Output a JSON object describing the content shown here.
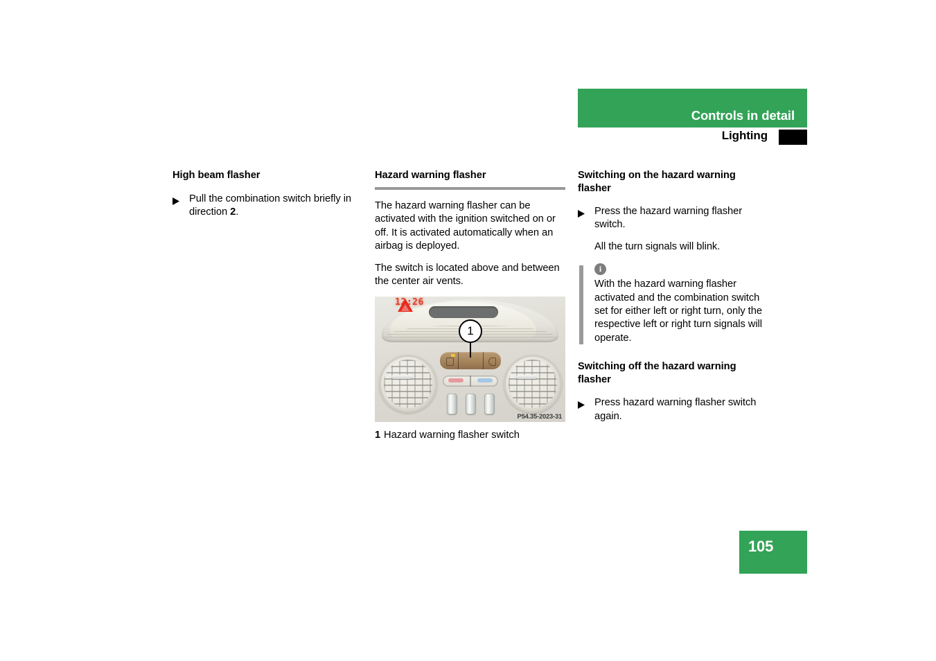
{
  "header": {
    "chapter_title": "Controls in detail",
    "section_title": "Lighting",
    "accent_color": "#33a357",
    "tab_color": "#000000"
  },
  "page_number": "105",
  "columns": {
    "col1": {
      "heading": "High beam flasher",
      "bullets": [
        {
          "text_before": "Pull the combination switch briefly in direction ",
          "bold": "2",
          "text_after": "."
        }
      ]
    },
    "col2": {
      "heading": "Hazard warning flasher",
      "has_rule": true,
      "paragraphs": [
        "The hazard warning flasher can be activated with the ignition switched on or off. It is activated automatically when an airbag is deployed.",
        "The switch is located above and between the center air vents."
      ],
      "figure": {
        "watermark": "P54.35-2023-31",
        "clock_value": "12:26",
        "callout_number": "1",
        "slider_labels": [
          "❄",
          "○",
          "‖"
        ],
        "caption_number": "1",
        "caption_text": "Hazard warning flasher switch"
      }
    },
    "col3": {
      "heading_on": "Switching on the hazard warning flasher",
      "bullet_on": "Press the hazard warning flasher switch.",
      "result_on": "All the turn signals will blink.",
      "note": {
        "icon": "info-icon",
        "text": "With the hazard warning flasher activated and the combination switch set for either left or right turn, only the respective left or right turn signals will operate."
      },
      "heading_off": "Switching off the hazard warning flasher",
      "bullet_off": "Press hazard warning flasher switch again."
    }
  }
}
